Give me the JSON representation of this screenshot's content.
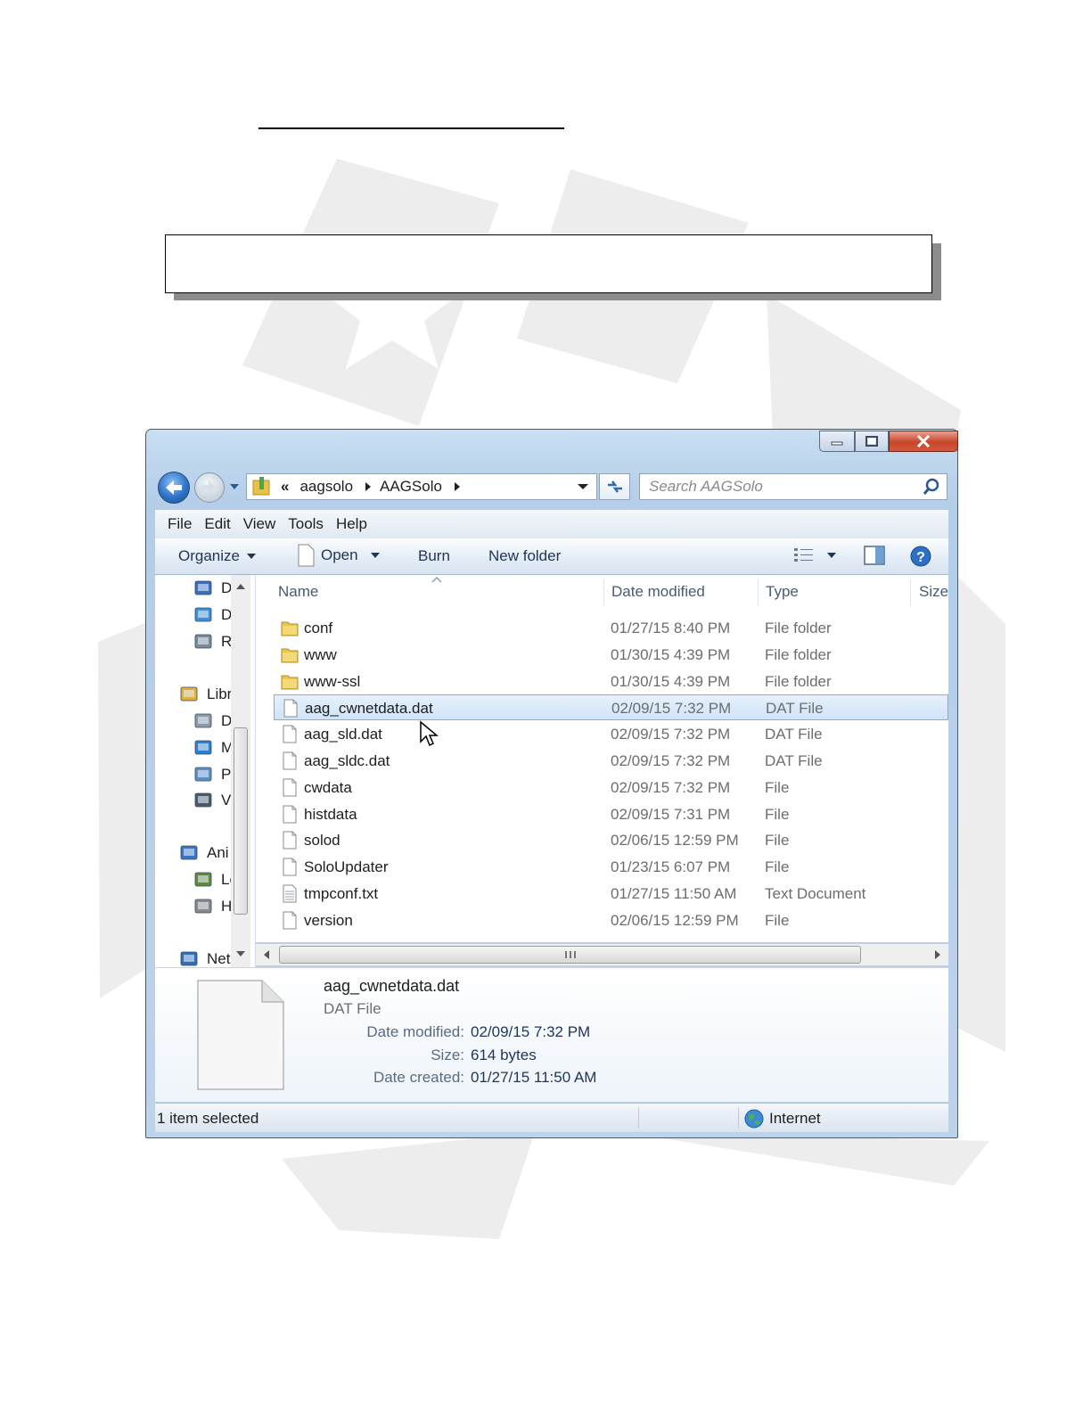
{
  "window": {
    "address_segments": [
      "aagsolo",
      "AAGSolo"
    ],
    "address_overflow": "«",
    "search_placeholder": "Search AAGSolo"
  },
  "menu": [
    "File",
    "Edit",
    "View",
    "Tools",
    "Help"
  ],
  "toolbar": {
    "organize": "Organize",
    "open": "Open",
    "burn": "Burn",
    "new_folder": "New folder"
  },
  "nav_pane": [
    {
      "icon": "desktop-icon",
      "label": "D"
    },
    {
      "icon": "downloads-icon",
      "label": "D"
    },
    {
      "icon": "recent-places-icon",
      "label": "R"
    },
    {
      "icon": "libraries-icon",
      "label": "Libr"
    },
    {
      "icon": "documents-icon",
      "label": "D"
    },
    {
      "icon": "music-icon",
      "label": "M"
    },
    {
      "icon": "pictures-icon",
      "label": "P"
    },
    {
      "icon": "videos-icon",
      "label": "V"
    },
    {
      "icon": "homegroup-icon",
      "label": "Ani"
    },
    {
      "icon": "local-disk-icon",
      "label": "Lo"
    },
    {
      "icon": "hard-drive-icon",
      "label": "H"
    },
    {
      "icon": "network-icon",
      "label": "Net"
    }
  ],
  "columns": [
    "Name",
    "Date modified",
    "Type",
    "Size"
  ],
  "files": [
    {
      "name": "conf",
      "date": "01/27/15 8:40 PM",
      "type": "File folder",
      "icon": "folder-icon"
    },
    {
      "name": "www",
      "date": "01/30/15 4:39 PM",
      "type": "File folder",
      "icon": "folder-icon"
    },
    {
      "name": "www-ssl",
      "date": "01/30/15 4:39 PM",
      "type": "File folder",
      "icon": "folder-icon"
    },
    {
      "name": "aag_cwnetdata.dat",
      "date": "02/09/15 7:32 PM",
      "type": "DAT File",
      "icon": "file-icon",
      "selected": true
    },
    {
      "name": "aag_sld.dat",
      "date": "02/09/15 7:32 PM",
      "type": "DAT File",
      "icon": "file-icon"
    },
    {
      "name": "aag_sldc.dat",
      "date": "02/09/15 7:32 PM",
      "type": "DAT File",
      "icon": "file-icon"
    },
    {
      "name": "cwdata",
      "date": "02/09/15 7:32 PM",
      "type": "File",
      "icon": "file-icon"
    },
    {
      "name": "histdata",
      "date": "02/09/15 7:31 PM",
      "type": "File",
      "icon": "file-icon"
    },
    {
      "name": "solod",
      "date": "02/06/15 12:59 PM",
      "type": "File",
      "icon": "file-icon"
    },
    {
      "name": "SoloUpdater",
      "date": "01/23/15 6:07 PM",
      "type": "File",
      "icon": "file-icon"
    },
    {
      "name": "tmpconf.txt",
      "date": "01/27/15 11:50 AM",
      "type": "Text Document",
      "icon": "text-file-icon"
    },
    {
      "name": "version",
      "date": "02/06/15 12:59 PM",
      "type": "File",
      "icon": "file-icon"
    }
  ],
  "details": {
    "name": "aag_cwnetdata.dat",
    "type": "DAT File",
    "date_modified_label": "Date modified:",
    "date_modified": "02/09/15 7:32 PM",
    "size_label": "Size:",
    "size": "614 bytes",
    "date_created_label": "Date created:",
    "date_created": "01/27/15 11:50 AM"
  },
  "status": {
    "selection": "1 item selected",
    "zone": "Internet"
  },
  "colors": {
    "selection_fill": "#cfe4f8",
    "selection_border": "#84acdd",
    "chrome": "#bcd4ec",
    "close_button": "#c8452c"
  }
}
